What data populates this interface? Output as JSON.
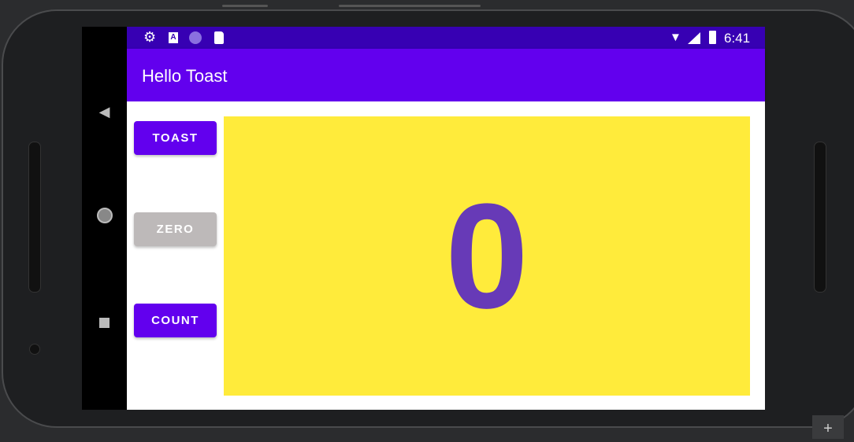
{
  "status_bar": {
    "time": "6:41",
    "icons_left": [
      "settings-icon",
      "a-icon",
      "circle-icon",
      "sd-card-icon"
    ],
    "icons_right": [
      "wifi-icon",
      "signal-icon",
      "battery-icon"
    ]
  },
  "app_bar": {
    "title": "Hello Toast"
  },
  "buttons": {
    "toast": "TOAST",
    "zero": "ZERO",
    "count": "COUNT"
  },
  "counter": {
    "value": "0"
  },
  "colors": {
    "primary": "#6200ee",
    "primary_dark": "#3700b3",
    "count_bg": "#ffeb3b",
    "count_text": "#673ab7",
    "zero_btn": "#bdb9b9"
  }
}
